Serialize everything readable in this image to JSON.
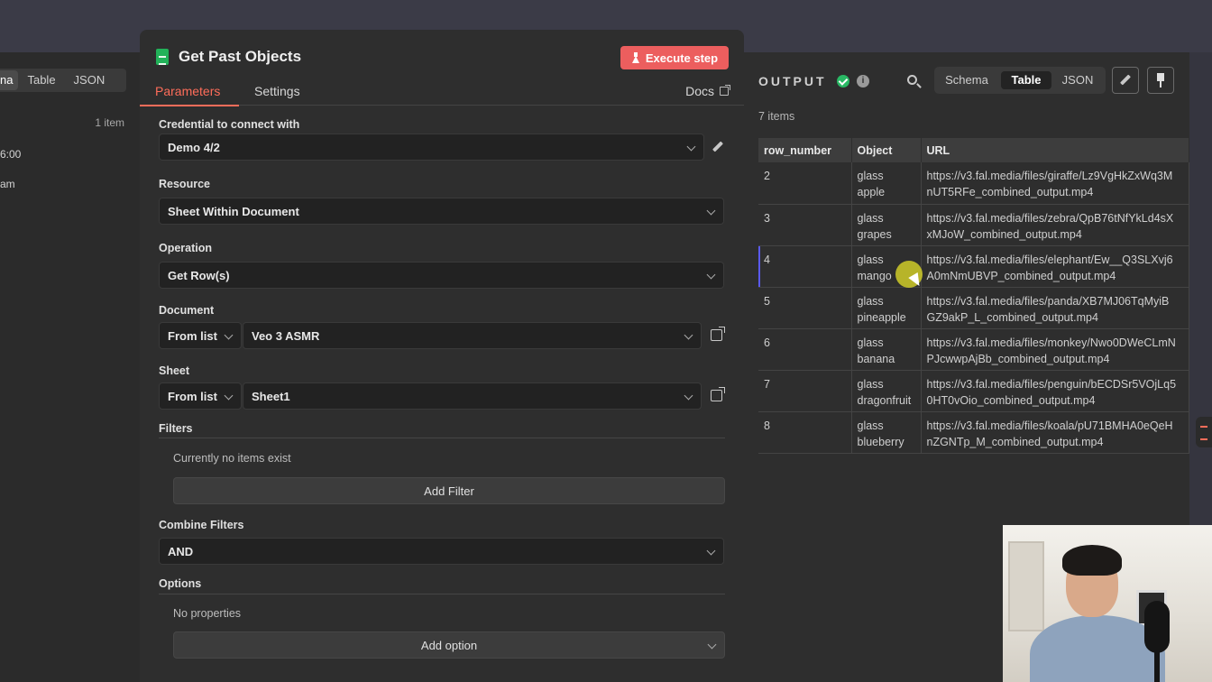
{
  "left": {
    "tabs": [
      "na",
      "Table",
      "JSON"
    ],
    "count": "1 item",
    "lines": [
      "6:00",
      "am"
    ]
  },
  "node": {
    "title": "Get Past Objects",
    "execute_label": "Execute step",
    "tabs": {
      "parameters": "Parameters",
      "settings": "Settings"
    },
    "docs_label": "Docs",
    "accent": "#ff6d5a",
    "execute_color": "#ec5e5e"
  },
  "params": {
    "credential": {
      "label": "Credential to connect with",
      "value": "Demo 4/2"
    },
    "resource": {
      "label": "Resource",
      "value": "Sheet Within Document"
    },
    "operation": {
      "label": "Operation",
      "value": "Get Row(s)"
    },
    "document": {
      "label": "Document",
      "mode": "From list",
      "value": "Veo 3 ASMR"
    },
    "sheet": {
      "label": "Sheet",
      "mode": "From list",
      "value": "Sheet1"
    },
    "filters": {
      "label": "Filters",
      "empty": "Currently no items exist",
      "add_label": "Add Filter"
    },
    "combine": {
      "label": "Combine Filters",
      "value": "AND"
    },
    "options": {
      "label": "Options",
      "empty": "No properties",
      "add_label": "Add option"
    }
  },
  "output": {
    "label": "OUTPUT",
    "view_tabs": [
      "Schema",
      "Table",
      "JSON"
    ],
    "active_view": "Table",
    "items_count": "7 items",
    "columns": [
      "row_number",
      "Object",
      "URL"
    ],
    "rows": [
      {
        "row_number": "2",
        "object": "glass\napple",
        "url": "https://v3.fal.media/files/giraffe/Lz9VgHkZxWq3M\nnUT5RFe_combined_output.mp4"
      },
      {
        "row_number": "3",
        "object": "glass\ngrapes",
        "url": "https://v3.fal.media/files/zebra/QpB76tNfYkLd4sX\nxMJoW_combined_output.mp4"
      },
      {
        "row_number": "4",
        "object": "glass\nmango",
        "url": "https://v3.fal.media/files/elephant/Ew__Q3SLXvj6\nA0mNmUBVP_combined_output.mp4"
      },
      {
        "row_number": "5",
        "object": "glass\npineapple",
        "url": "https://v3.fal.media/files/panda/XB7MJ06TqMyiB\nGZ9akP_L_combined_output.mp4"
      },
      {
        "row_number": "6",
        "object": "glass\nbanana",
        "url": "https://v3.fal.media/files/monkey/Nwo0DWeCLmN\nPJcwwpAjBb_combined_output.mp4"
      },
      {
        "row_number": "7",
        "object": "glass\ndragonfruit",
        "url": "https://v3.fal.media/files/penguin/bECDSr5VOjLq5\n0HT0vOio_combined_output.mp4"
      },
      {
        "row_number": "8",
        "object": "glass\nblueberry",
        "url": "https://v3.fal.media/files/koala/pU71BMHA0eQeH\nnZGNTp_M_combined_output.mp4"
      }
    ]
  }
}
